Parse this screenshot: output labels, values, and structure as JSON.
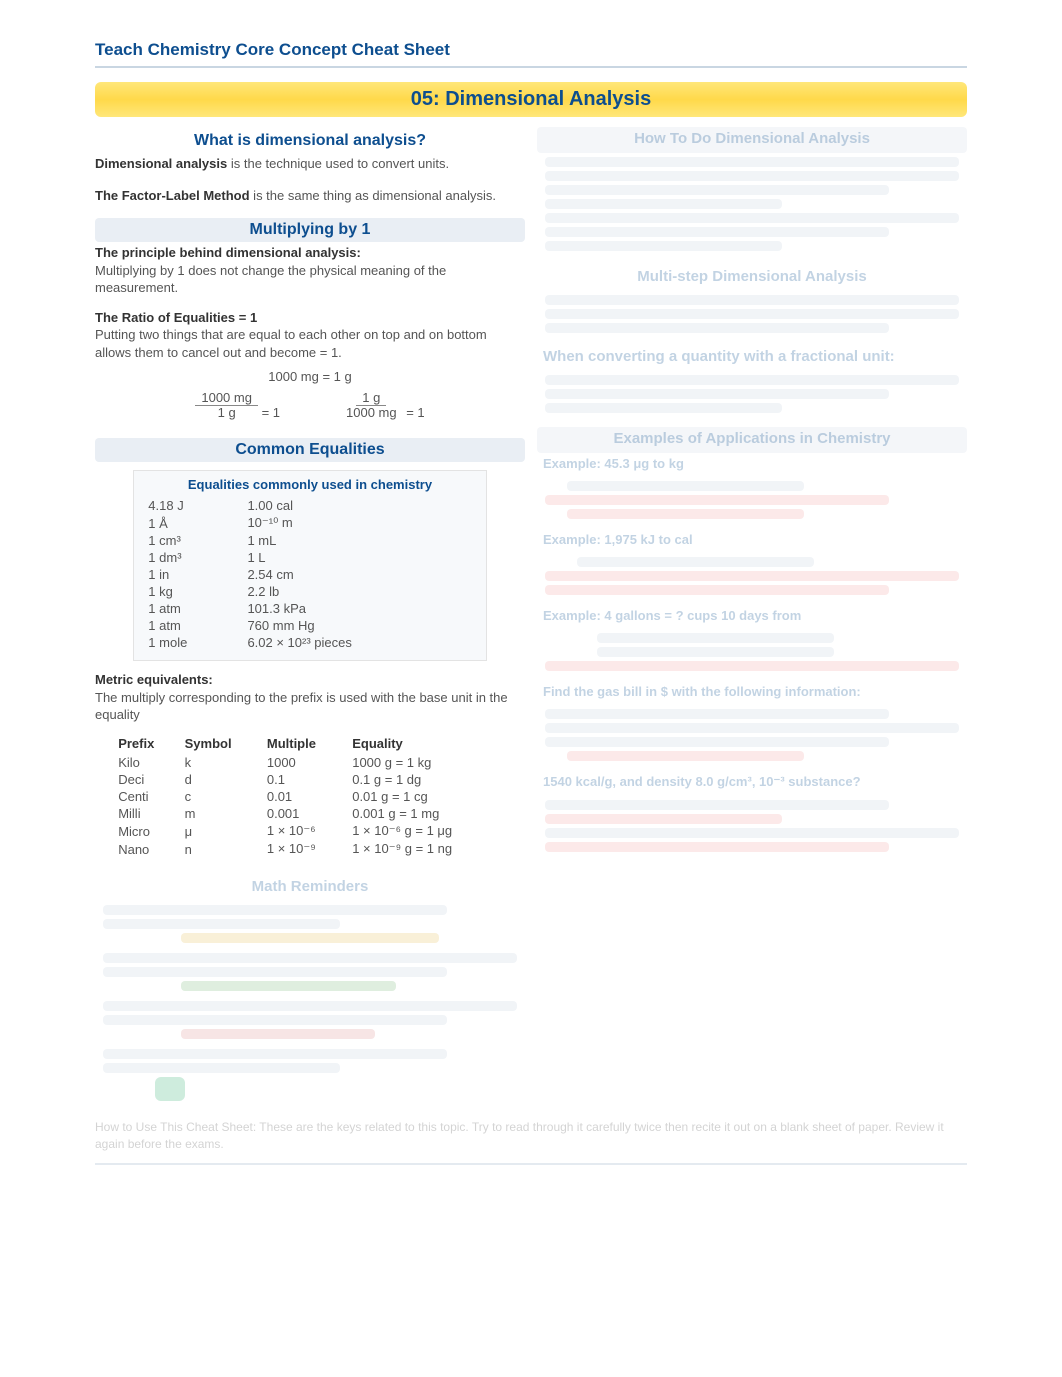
{
  "brand": "Teach Chemistry Core Concept Cheat Sheet",
  "main_title": "05: Dimensional Analysis",
  "left": {
    "s1": {
      "head": "What is dimensional analysis?",
      "p1a": "Dimensional analysis",
      "p1b": " is the technique used to convert units.",
      "p2a": "The Factor-Label Method",
      "p2b": " is the same thing as dimensional analysis."
    },
    "s2": {
      "head": "Multiplying by 1",
      "p1a": "The principle behind dimensional analysis:",
      "p1b": "Multiplying by 1 does not change the physical meaning of the measurement.",
      "p2a": "The Ratio of Equalities = 1",
      "p2b": "Putting two things that are equal to each other on top and on bottom allows them to cancel out and become = 1.",
      "eq_center": "1000 mg = 1 g",
      "frac1_top": "1000 mg",
      "frac1_bot": "1 g",
      "frac1_eq": " = 1",
      "frac2_top": "1 g",
      "frac2_bot": "1000 mg",
      "frac2_eq": " = 1"
    },
    "s3": {
      "head": "Common Equalities",
      "table_title": "Equalities commonly used in chemistry",
      "rows": [
        [
          "4.18 J",
          "1.00 cal"
        ],
        [
          "1 Å",
          "10⁻¹⁰ m"
        ],
        [
          "1 cm³",
          "1 mL"
        ],
        [
          "1 dm³",
          "1 L"
        ],
        [
          "1 in",
          "2.54 cm"
        ],
        [
          "1 kg",
          "2.2 lb"
        ],
        [
          "1 atm",
          "101.3 kPa"
        ],
        [
          "1 atm",
          "760 mm Hg"
        ],
        [
          "1 mole",
          "6.02 × 10²³ pieces"
        ]
      ],
      "metric_head": "Metric equivalents:",
      "metric_text": "The multiply corresponding to the prefix is used with the base unit in the equality",
      "prefix_head": [
        "Prefix",
        "Symbol",
        "Multiple",
        "Equality"
      ],
      "prefix_rows": [
        [
          "Kilo",
          "k",
          "1000",
          "1000 g = 1 kg"
        ],
        [
          "Deci",
          "d",
          "0.1",
          "0.1 g = 1 dg"
        ],
        [
          "Centi",
          "c",
          "0.01",
          "0.01 g = 1 cg"
        ],
        [
          "Milli",
          "m",
          "0.001",
          "0.001 g = 1 mg"
        ],
        [
          "Micro",
          "μ",
          "1 × 10⁻⁶",
          "1 × 10⁻⁶ g = 1 μg"
        ],
        [
          "Nano",
          "n",
          "1 × 10⁻⁹",
          "1 × 10⁻⁹ g = 1 ng"
        ]
      ]
    },
    "s4": {
      "head": "Math Reminders"
    }
  },
  "right": {
    "h1": "How To Do Dimensional Analysis",
    "h2": "Multi-step Dimensional Analysis",
    "h3": "When converting a quantity with a fractional unit:",
    "h4": "Examples of Applications in Chemistry",
    "ex1": "Example: 45.3 μg to kg",
    "ex2": "Example: 1,975 kJ to cal",
    "ex3": "Example: 4 gallons = ? cups 10 days from",
    "ex4": "Find the gas bill in $ with the following information:",
    "ex5": "1540 kcal/g, and density 8.0 g/cm³, 10⁻³ substance?"
  },
  "footer": "How to Use This Cheat Sheet: These are the keys related to this topic. Try to read through it carefully twice then recite it out on a blank sheet of paper. Review it again before the exams."
}
